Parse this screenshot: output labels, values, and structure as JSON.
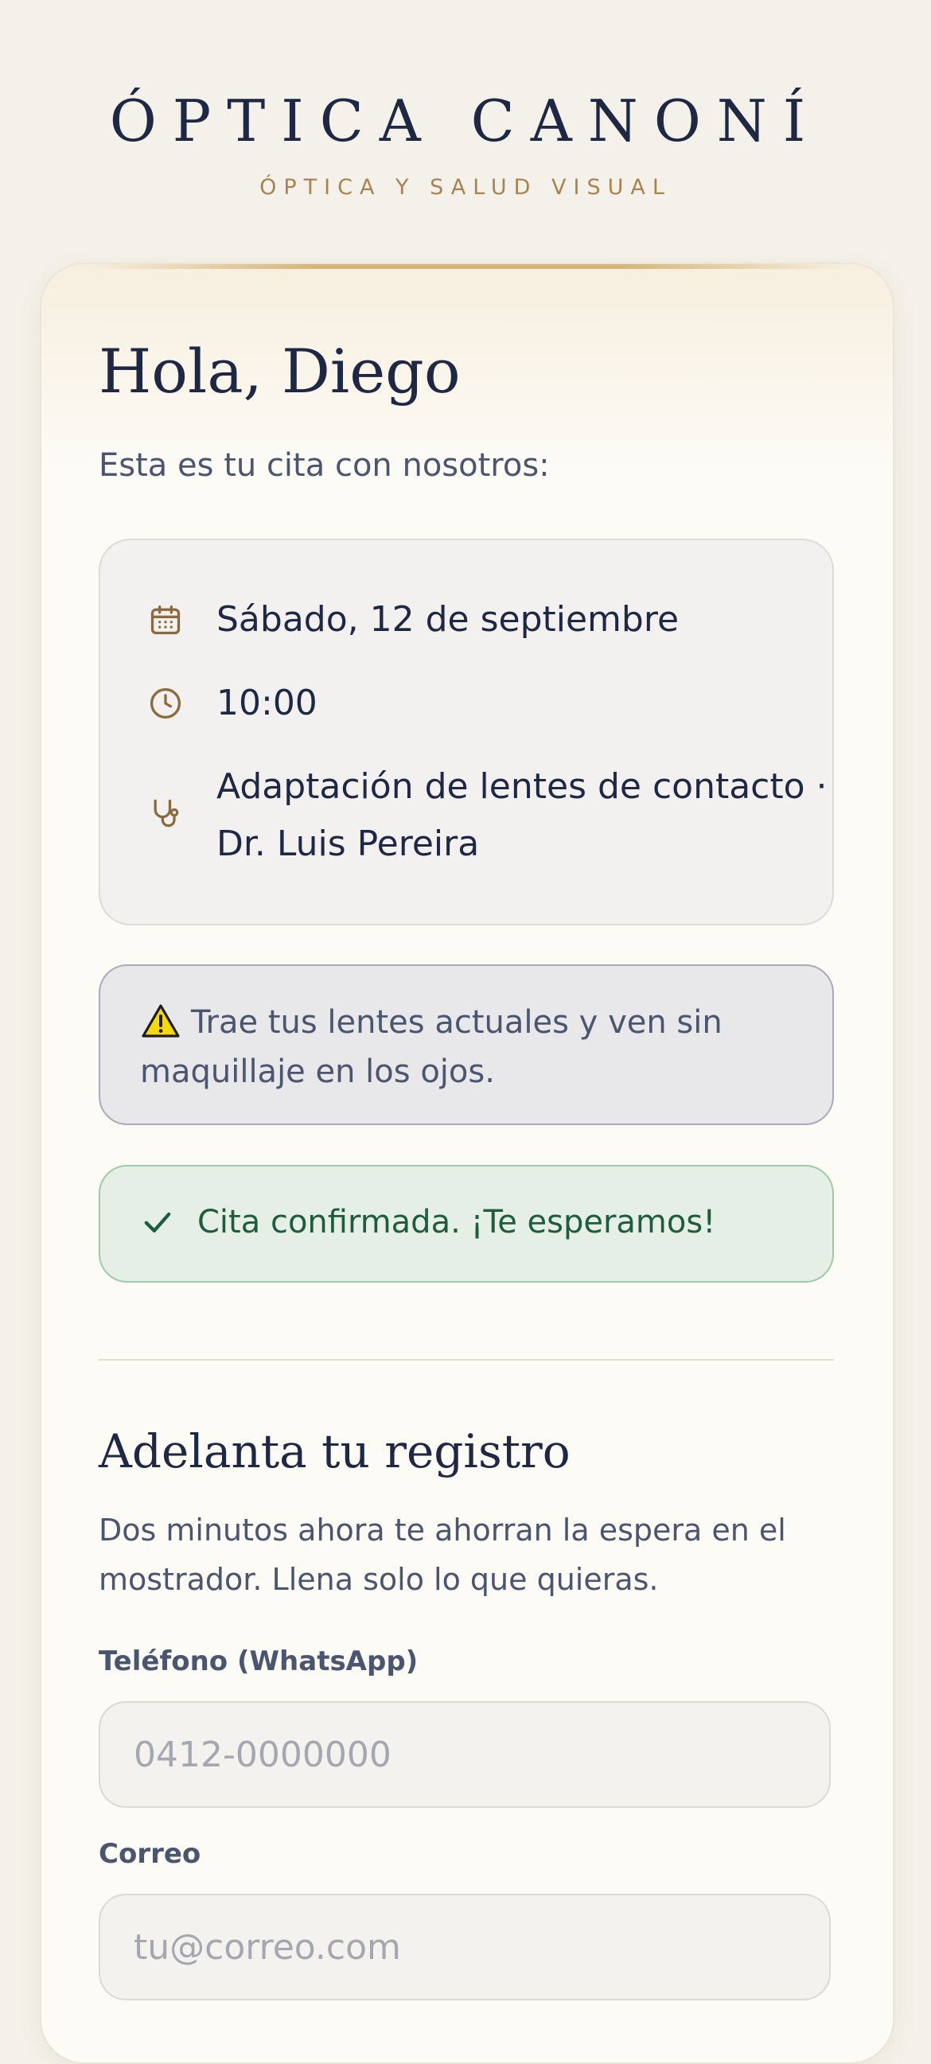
{
  "header": {
    "brand": "ÓPTICA CANONÍ",
    "tagline": "ÓPTICA Y SALUD VISUAL"
  },
  "greeting": "Hola, Diego",
  "intro": "Esta es tu cita con nosotros:",
  "appointment": {
    "date": "Sábado, 12 de septiembre",
    "time": "10:00",
    "service_line1": "Adaptación de lentes de contacto ·",
    "service_line2": "Dr. Luis Pereira",
    "icons": [
      "calendar-icon",
      "clock-icon",
      "stethoscope-icon"
    ]
  },
  "notice": {
    "icon": "warning-icon",
    "text": "Trae tus lentes actuales y ven sin maquillaje en los ojos."
  },
  "status": {
    "icon": "check-icon",
    "text": "Cita confirmada. ¡Te esperamos!"
  },
  "registration": {
    "title": "Adelanta tu registro",
    "description": "Dos minutos ahora te ahorran la espera en el mostrador. Llena solo lo que quieras.",
    "phone_label": "Teléfono (WhatsApp)",
    "phone_placeholder": "0412-0000000",
    "email_label": "Correo",
    "email_placeholder": "tu@correo.com"
  },
  "colors": {
    "navy": "#1e2844",
    "gold": "#a88350",
    "success": "#1d5c3d",
    "background": "#f4f1ea"
  }
}
